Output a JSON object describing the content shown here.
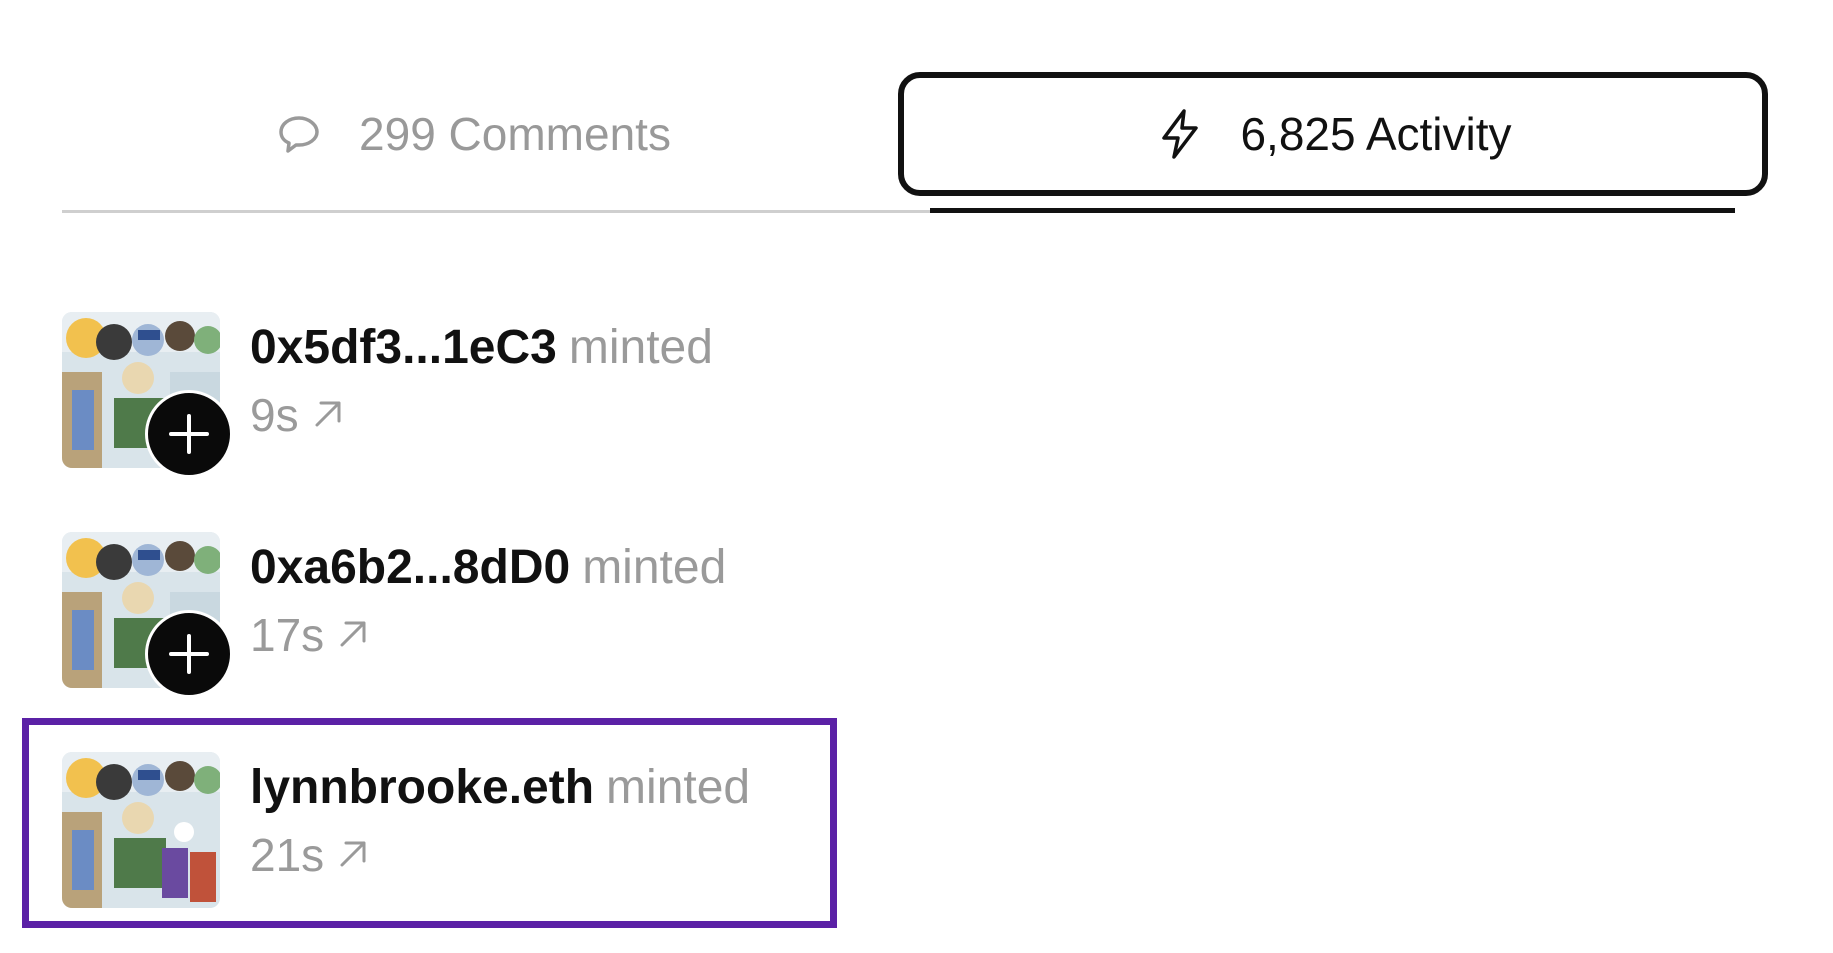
{
  "tabs": {
    "comments": {
      "label": "299 Comments",
      "icon": "speech-bubble-icon"
    },
    "activity": {
      "label": "6,825 Activity",
      "icon": "lightning-bolt-icon",
      "active": true
    }
  },
  "activity": [
    {
      "actor": "0x5df3...1eC3",
      "action": "minted",
      "time": "9s",
      "badge": "plus-icon"
    },
    {
      "actor": "0xa6b2...8dD0",
      "action": "minted",
      "time": "17s",
      "badge": "plus-icon"
    },
    {
      "actor": "lynnbrooke.eth",
      "action": "minted",
      "time": "21s",
      "badge": null
    }
  ],
  "colors": {
    "highlight": "#5b21a6",
    "muted_text": "#9a9a9a",
    "primary_text": "#111111"
  }
}
